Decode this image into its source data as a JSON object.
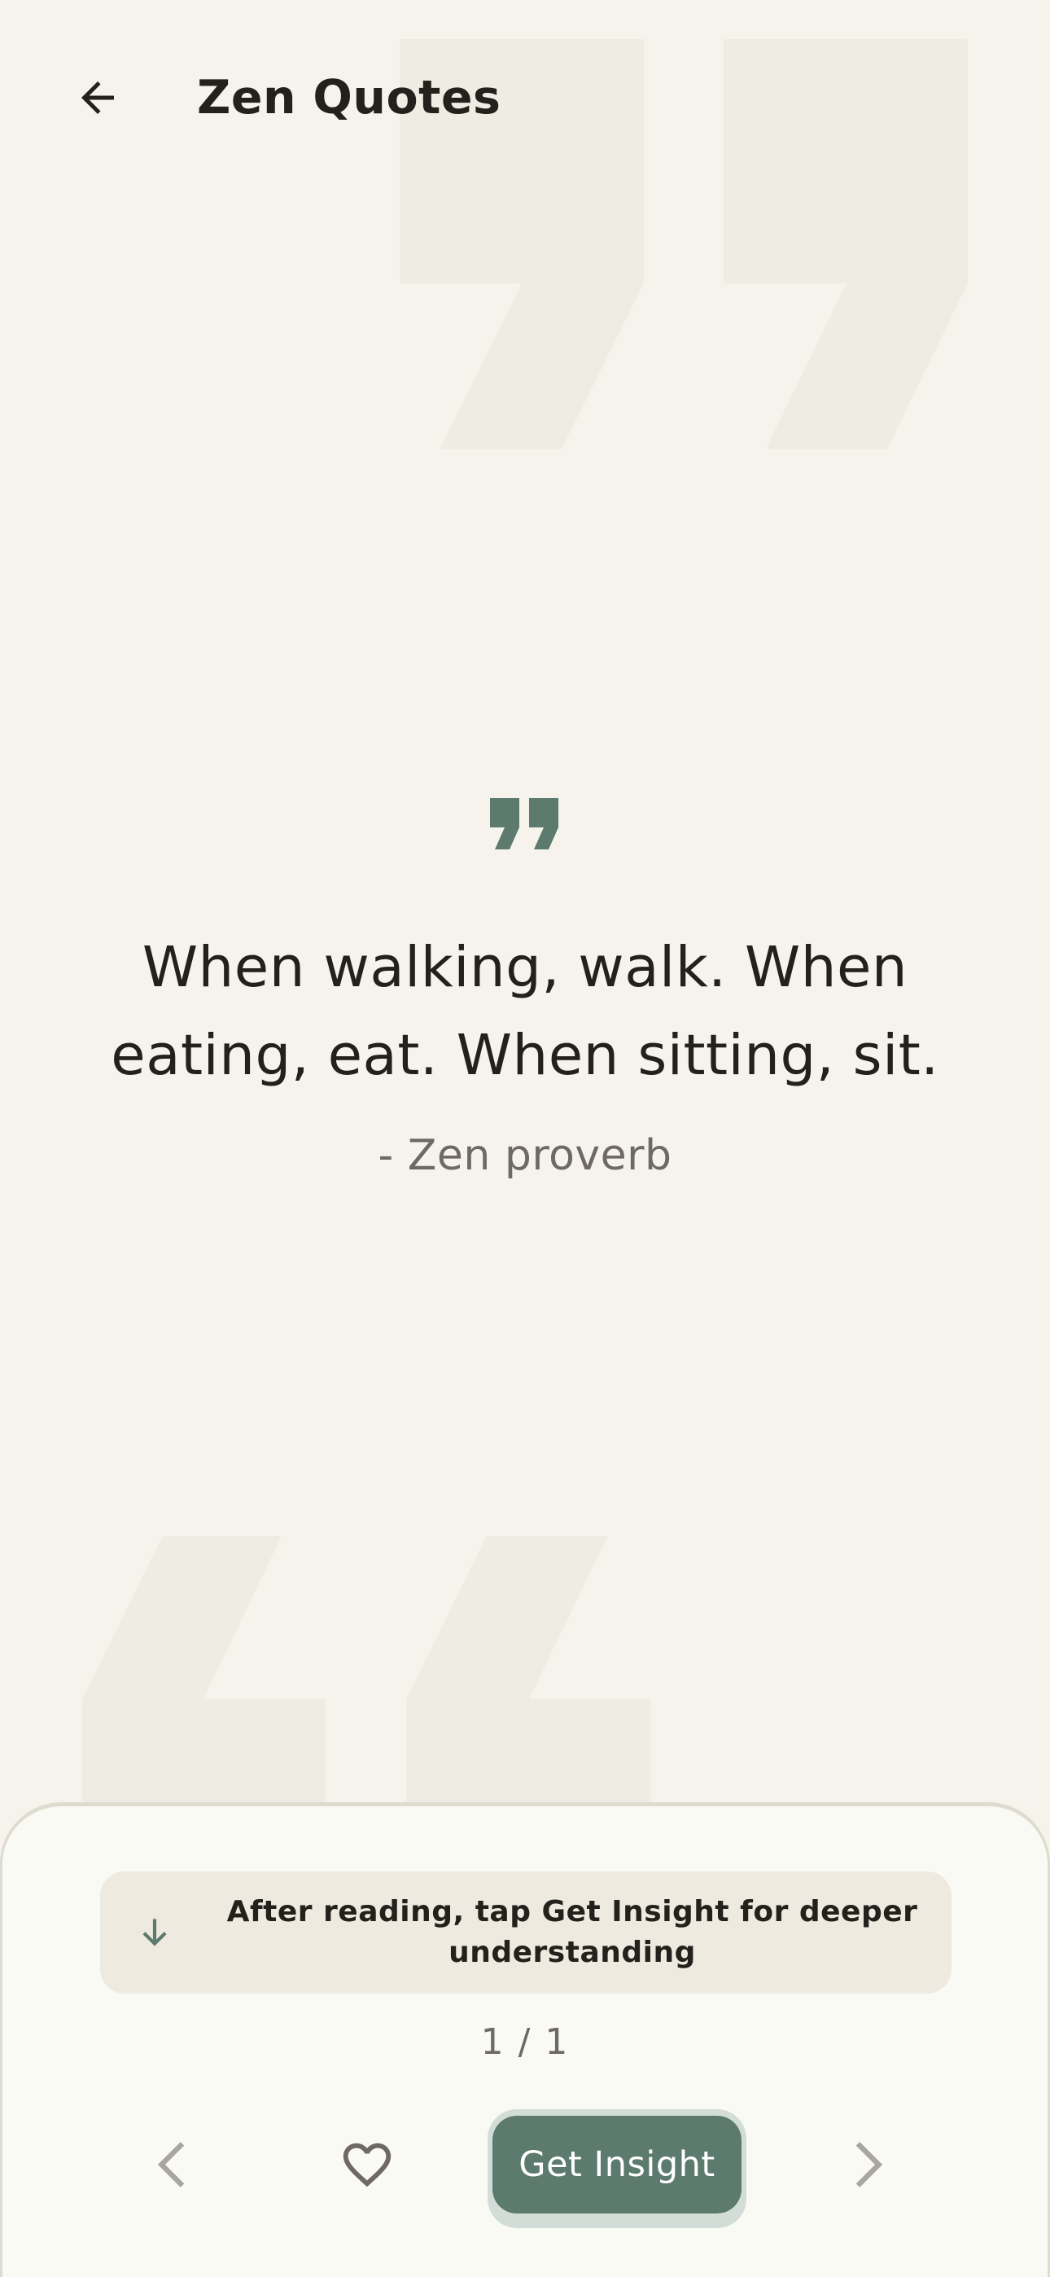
{
  "app": {
    "title": "Zen Quotes"
  },
  "icons": {
    "back": "arrow-left-icon",
    "quote": "quote-mark-icon",
    "hint": "arrow-down-icon",
    "prev": "chevron-left-icon",
    "favorite": "heart-outline-icon",
    "next": "chevron-right-icon"
  },
  "quote": {
    "text": "When walking, walk. When eating, eat. When sitting, sit.",
    "author": "- Zen proverb"
  },
  "sheet": {
    "hint": "After reading, tap Get Insight for deeper understanding",
    "counter": "1 / 1",
    "insight_label": "Get Insight"
  },
  "colors": {
    "background": "#f6f3ec",
    "accent": "#5c7a6d",
    "decor": "#efece3",
    "sheet": "#fafaf5",
    "hint_bg": "#efeae0",
    "text_primary": "#23211c",
    "text_secondary": "#6e6963"
  }
}
